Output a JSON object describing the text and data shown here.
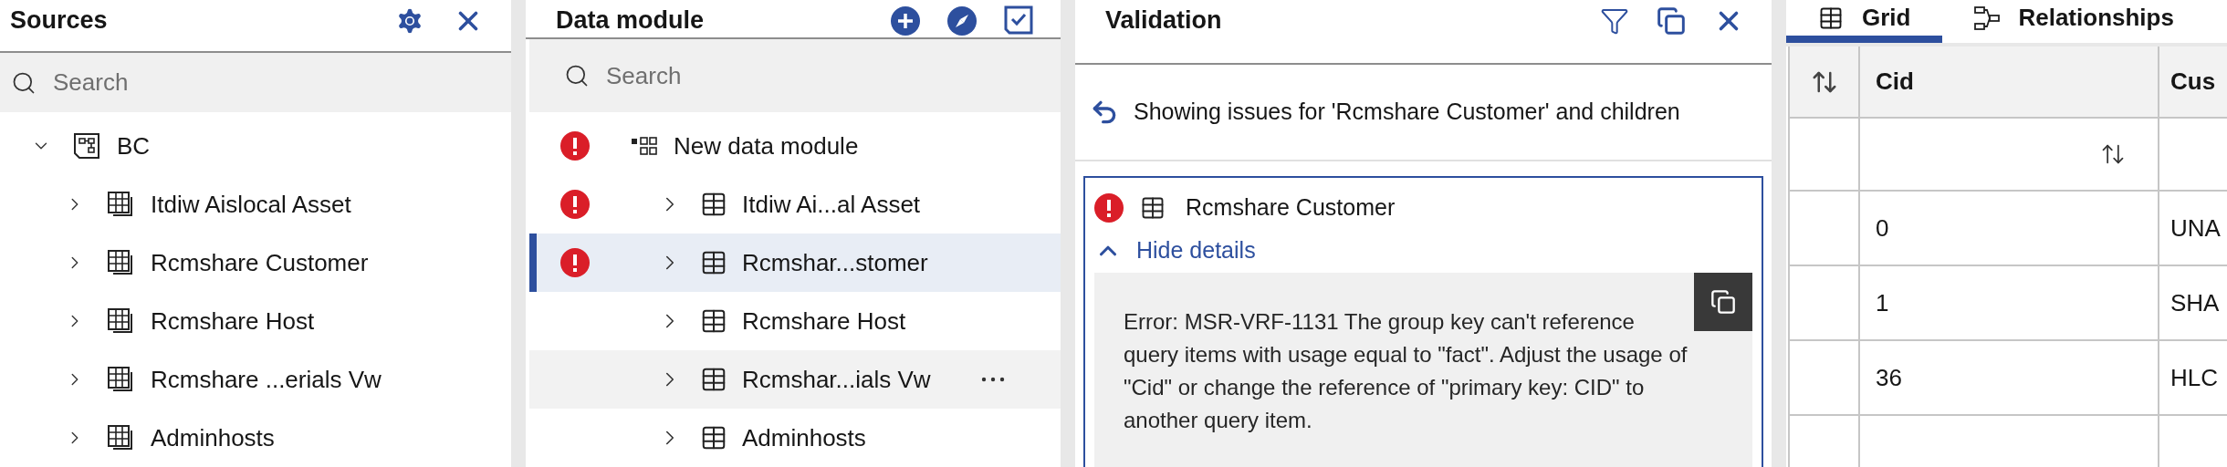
{
  "sources": {
    "title": "Sources",
    "search": {
      "placeholder": "Search"
    },
    "tree": [
      {
        "label": "BC",
        "kind": "module",
        "expanded": true,
        "children": [
          {
            "label": "Itdiw Aislocal Asset",
            "kind": "table",
            "expanded": false
          },
          {
            "label": "Rcmshare Customer",
            "kind": "table",
            "expanded": false
          },
          {
            "label": "Rcmshare Host",
            "kind": "table",
            "expanded": false
          },
          {
            "label": "Rcmshare ...erials Vw",
            "kind": "table",
            "expanded": false
          },
          {
            "label": "Adminhosts",
            "kind": "table",
            "expanded": false
          }
        ]
      }
    ]
  },
  "data_module": {
    "title": "Data module",
    "search": {
      "placeholder": "Search"
    },
    "items": [
      {
        "label": "New data module",
        "kind": "module",
        "error": true,
        "selected": false,
        "hovered": false
      },
      {
        "label": "Itdiw Ai...al Asset",
        "kind": "table",
        "expanded": false,
        "error": true,
        "selected": false,
        "hovered": false
      },
      {
        "label": "Rcmshar...stomer",
        "kind": "table",
        "expanded": false,
        "error": true,
        "selected": true,
        "hovered": false
      },
      {
        "label": "Rcmshare Host",
        "kind": "table",
        "expanded": false,
        "error": false,
        "selected": false,
        "hovered": false
      },
      {
        "label": "Rcmshar...ials Vw",
        "kind": "table",
        "expanded": false,
        "error": false,
        "selected": false,
        "hovered": true
      },
      {
        "label": "Adminhosts",
        "kind": "table",
        "expanded": false,
        "error": false,
        "selected": false,
        "hovered": false
      }
    ]
  },
  "validation": {
    "title": "Validation",
    "scope_note": "Showing issues for 'Rcmshare Customer' and children",
    "issues": [
      {
        "label": "Rcmshare Customer",
        "error": true,
        "details_expanded": true,
        "toggle_label": "Hide details",
        "message": "Error: MSR-VRF-1131 The group key can't reference query items with usage equal to \"fact\". Adjust the usage of \"Cid\" or change the reference of \"primary key: CID\" to another query item."
      }
    ]
  },
  "grid": {
    "tabs": [
      {
        "label": "Grid",
        "kind": "grid",
        "selected": true
      },
      {
        "label": "Relationships",
        "kind": "relationships",
        "selected": false
      }
    ],
    "table": {
      "columns": [
        "Cid",
        "Cus"
      ],
      "rows": [
        [
          "0",
          "UNA"
        ],
        [
          "1",
          "SHA"
        ],
        [
          "36",
          "HLC"
        ],
        [
          "",
          ""
        ]
      ]
    }
  }
}
